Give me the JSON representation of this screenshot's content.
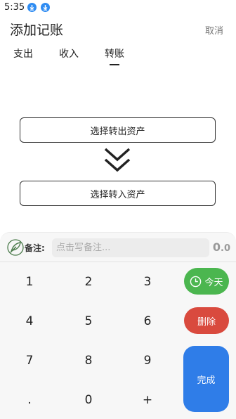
{
  "status": {
    "time": "5:35",
    "icons": [
      "download-icon",
      "download-icon"
    ]
  },
  "header": {
    "title": "添加记账",
    "cancel_label": "取消"
  },
  "tabs": [
    {
      "label": "支出"
    },
    {
      "label": "收入"
    },
    {
      "label": "转账",
      "active": true
    }
  ],
  "transfer": {
    "from_label": "选择转出资产",
    "to_label": "选择转入资产",
    "arrow_icon": "double-chevron-down-icon"
  },
  "remark": {
    "label": "备注:",
    "placeholder": "点击写备注...",
    "value": ""
  },
  "amount": {
    "integer": "0",
    "decimal": ".0"
  },
  "keypad": {
    "keys": [
      "1",
      "2",
      "3",
      "4",
      "5",
      "6",
      "7",
      "8",
      "9",
      ".",
      "0",
      "+"
    ]
  },
  "actions": {
    "today_label": "今天",
    "delete_label": "删除",
    "done_label": "完成"
  },
  "colors": {
    "accent_blue": "#2f7de8",
    "today_green": "#4bb64f",
    "delete_red": "#d94a3e"
  }
}
